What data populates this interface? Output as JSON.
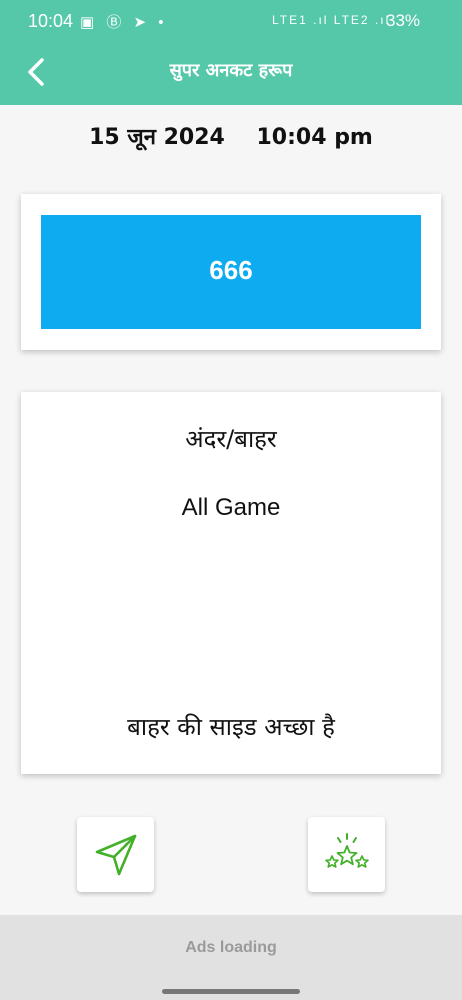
{
  "status_bar": {
    "time": "10:04",
    "notification_icons": "▣ Ⓑ ➤ •",
    "network": "LTE1 .ıl LTE2 .ıl",
    "battery": "33%"
  },
  "app_bar": {
    "back_icon": "chevron-left",
    "title": "सुपर अनकट हरूप"
  },
  "date_time": {
    "date": "15 जून 2024",
    "time": "10:04 pm"
  },
  "number_card": {
    "number": "666"
  },
  "info_card": {
    "title": "अंदर/बाहर",
    "subtitle": "All Game",
    "footer": "बाहर की साइड अच्छा है"
  },
  "actions": [
    {
      "icon": "send-icon"
    },
    {
      "icon": "rate-stars-icon"
    }
  ],
  "ads": {
    "label": "Ads loading"
  },
  "colors": {
    "header": "#55c8aa",
    "number_box": "#0fabf0",
    "icon_green": "#43b02a"
  }
}
